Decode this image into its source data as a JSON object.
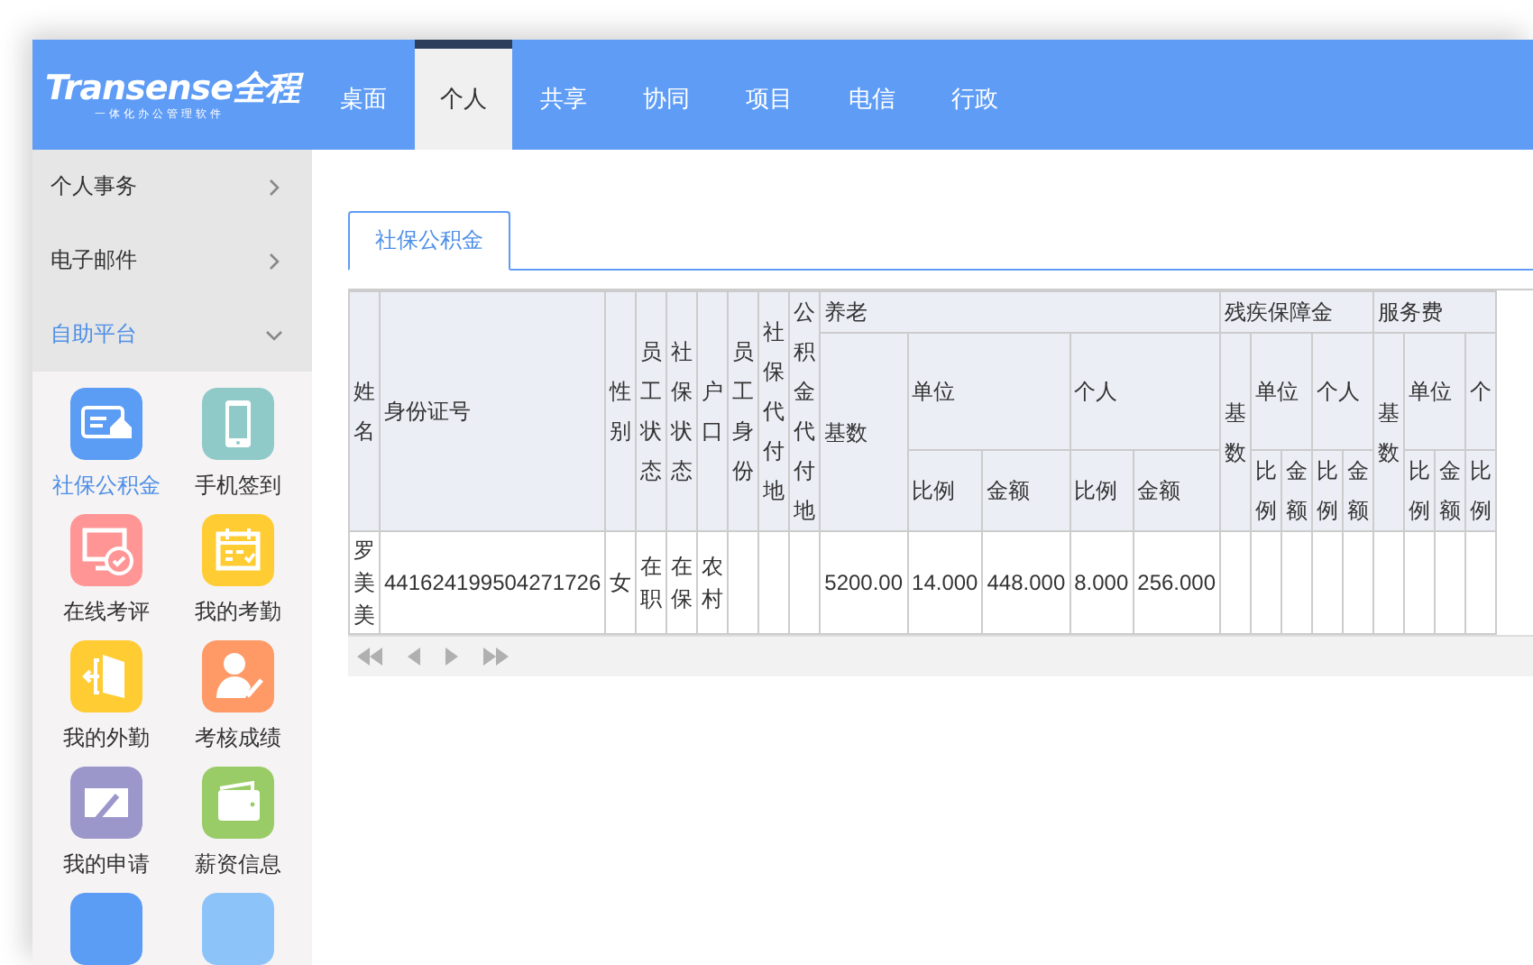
{
  "header": {
    "logo": "Transense全程",
    "slogan": "一体化办公管理软件",
    "tabs": [
      {
        "label": "桌面",
        "selected": false
      },
      {
        "label": "个人",
        "selected": true
      },
      {
        "label": "共享",
        "selected": false
      },
      {
        "label": "协同",
        "selected": false
      },
      {
        "label": "项目",
        "selected": false
      },
      {
        "label": "电信",
        "selected": false
      },
      {
        "label": "行政",
        "selected": false
      }
    ]
  },
  "sidebar": {
    "items": [
      {
        "label": "个人事务",
        "expanded": false
      },
      {
        "label": "电子邮件",
        "expanded": false
      },
      {
        "label": "自助平台",
        "expanded": true
      }
    ],
    "apps": [
      {
        "label": "社保公积金",
        "color": "#5b9cf5",
        "selected": true
      },
      {
        "label": "手机签到",
        "color": "#8fcac8",
        "selected": false
      },
      {
        "label": "在线考评",
        "color": "#ff9595",
        "selected": false
      },
      {
        "label": "我的考勤",
        "color": "#ffcc33",
        "selected": false
      },
      {
        "label": "我的外勤",
        "color": "#ffcc33",
        "selected": false
      },
      {
        "label": "考核成绩",
        "color": "#ff9966",
        "selected": false
      },
      {
        "label": "我的申请",
        "color": "#9b97cb",
        "selected": false
      },
      {
        "label": "薪资信息",
        "color": "#99cc66",
        "selected": false
      },
      {
        "color": "#5b9cf5"
      },
      {
        "color": "#8cc4f9"
      }
    ]
  },
  "content": {
    "tabs": [
      {
        "label": "社保公积金",
        "selected": true
      }
    ],
    "table": {
      "header_rows": [
        [
          {
            "label": "姓名",
            "rowspan": 3
          },
          {
            "label": "身份证号",
            "rowspan": 3
          },
          {
            "label": "性别",
            "rowspan": 3
          },
          {
            "label": "员工状态",
            "rowspan": 3
          },
          {
            "label": "社保状态",
            "rowspan": 3
          },
          {
            "label": "户口",
            "rowspan": 3
          },
          {
            "label": "员工身份",
            "rowspan": 3
          },
          {
            "label": "社保代付地",
            "rowspan": 3
          },
          {
            "label": "公积金代付地",
            "rowspan": 3
          },
          {
            "label": "养老",
            "colspan": 5
          },
          {
            "label": "残疾保障金",
            "colspan": 5
          },
          {
            "label": "服务费",
            "colspan": 4
          }
        ],
        [
          {
            "label": "基数",
            "rowspan": 2
          },
          {
            "label": "单位",
            "colspan": 2
          },
          {
            "label": "个人",
            "colspan": 2
          },
          {
            "label": "基数",
            "rowspan": 2
          },
          {
            "label": "单位",
            "colspan": 2
          },
          {
            "label": "个人",
            "colspan": 2
          },
          {
            "label": "基数",
            "rowspan": 2
          },
          {
            "label": "单位",
            "colspan": 2
          },
          {
            "label": "个"
          }
        ],
        [
          {
            "label": "比例"
          },
          {
            "label": "金额"
          },
          {
            "label": "比例"
          },
          {
            "label": "金额"
          },
          {
            "label": "比例"
          },
          {
            "label": "金额"
          },
          {
            "label": "比例"
          },
          {
            "label": "金额"
          },
          {
            "label": "比例"
          },
          {
            "label": "金额"
          },
          {
            "label": "比例"
          }
        ]
      ],
      "rows": [
        {
          "cells": [
            "罗美美",
            "441624199504271726",
            "女",
            "在职",
            "在保",
            "农村",
            null,
            null,
            null,
            "5200.00",
            "14.000",
            "448.000",
            "8.000",
            "256.000"
          ]
        }
      ]
    }
  }
}
